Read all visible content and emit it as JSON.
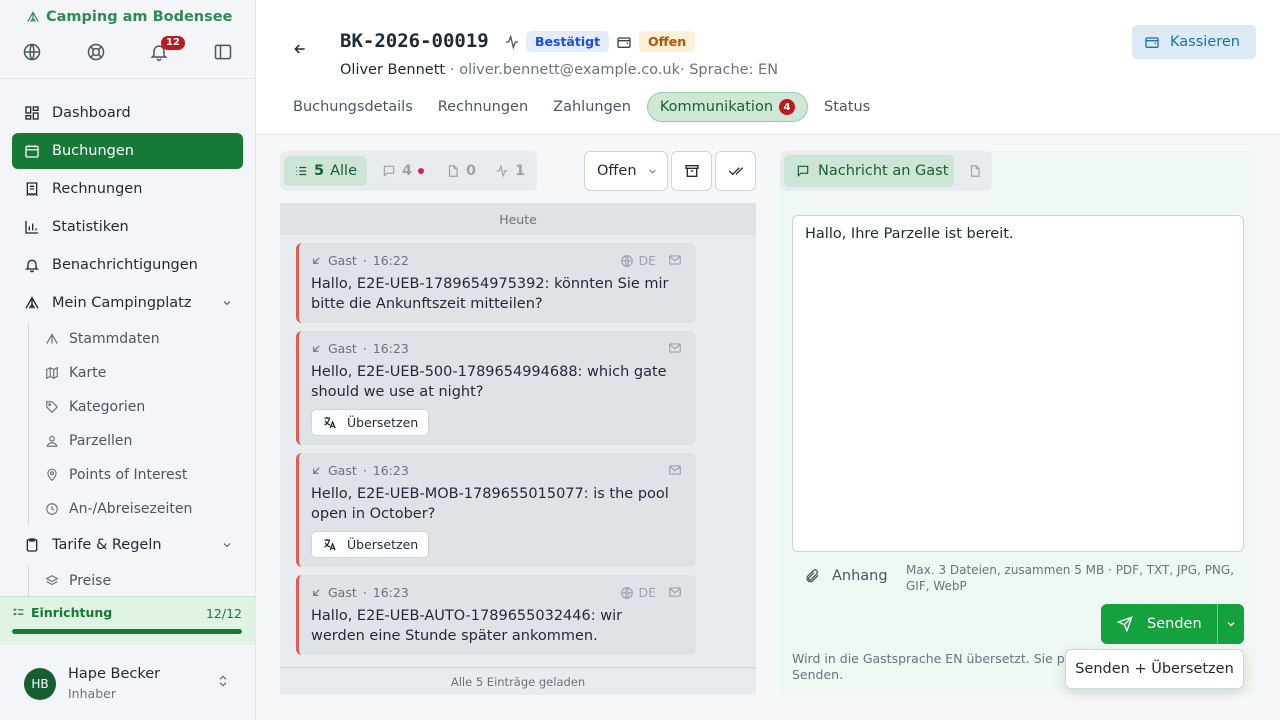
{
  "app": {
    "name": "Camping am Bodensee",
    "notif_count": "12"
  },
  "nav": {
    "dashboard": "Dashboard",
    "buchungen": "Buchungen",
    "rechnungen": "Rechnungen",
    "statistiken": "Statistiken",
    "benachrichtigungen": "Benachrichtigungen",
    "campingplatz": "Mein Campingplatz",
    "sub": [
      "Stammdaten",
      "Karte",
      "Kategorien",
      "Parzellen",
      "Points of Interest",
      "An-/Abreisezeiten"
    ],
    "tarife": "Tarife & Regeln",
    "preise": "Preise"
  },
  "setup": {
    "label": "Einrichtung",
    "count": "12/12",
    "progress": 1.0
  },
  "user": {
    "initials": "HB",
    "name": "Hape Becker",
    "role": "Inhaber"
  },
  "booking": {
    "id": "BK-2026-00019",
    "status": "Bestätigt",
    "payment": "Offen",
    "guest": "Oliver Bennett",
    "email": "· oliver.bennett@example.co.uk",
    "language": "· Sprache: EN"
  },
  "tabs": [
    {
      "label": "Buchungsdetails"
    },
    {
      "label": "Rechnungen"
    },
    {
      "label": "Zahlungen"
    },
    {
      "label": "Kommunikation",
      "badge": "4"
    },
    {
      "label": "Status"
    }
  ],
  "kassieren": "Kassieren",
  "filters": {
    "all_count": "5",
    "all_label": "Alle",
    "messages": "4",
    "docs": "0",
    "events": "1",
    "select": "Offen"
  },
  "feed": {
    "day": "Heute",
    "messages": [
      {
        "who": "Gast",
        "time": "16:22",
        "lang": "DE",
        "text": "Hallo, E2E-UEB-1789654975392: könnten Sie mir bitte die Ankunftszeit mitteilen?"
      },
      {
        "who": "Gast",
        "time": "16:23",
        "text": "Hello, E2E-UEB-500-1789654994688: which gate should we use at night?",
        "translate": "Übersetzen"
      },
      {
        "who": "Gast",
        "time": "16:23",
        "text": "Hello, E2E-UEB-MOB-1789655015077: is the pool open in October?",
        "translate": "Übersetzen"
      },
      {
        "who": "Gast",
        "time": "16:23",
        "lang": "DE",
        "text": "Hallo, E2E-UEB-AUTO-1789655032446: wir werden eine Stunde später ankommen."
      }
    ],
    "footer": "Alle 5 Einträge geladen"
  },
  "composer": {
    "tab": "Nachricht an Gast",
    "text": "Hallo, Ihre Parzelle ist bereit.",
    "attach": "Anhang",
    "attach_info": "Max. 3 Dateien, zusammen 5 MB · PDF, TXT, JPG, PNG, GIF, WebP",
    "send": "Senden",
    "hint1": "Wird in die Gastsprache EN übersetzt. Sie prü",
    "hint2": "Senden.",
    "popup": "Senden + Übersetzen"
  }
}
